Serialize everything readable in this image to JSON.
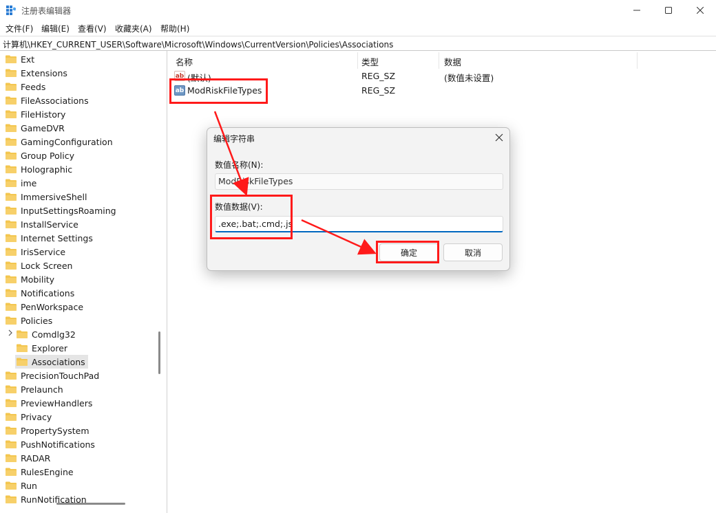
{
  "window": {
    "title": "注册表编辑器",
    "minimize_icon": "minimize-icon",
    "maximize_icon": "maximize-icon",
    "close_icon": "close-icon"
  },
  "menu": [
    "文件(F)",
    "编辑(E)",
    "查看(V)",
    "收藏夹(A)",
    "帮助(H)"
  ],
  "address": "计算机\\HKEY_CURRENT_USER\\Software\\Microsoft\\Windows\\CurrentVersion\\Policies\\Associations",
  "tree": {
    "items": [
      {
        "label": "Ext",
        "indent": 0
      },
      {
        "label": "Extensions",
        "indent": 0
      },
      {
        "label": "Feeds",
        "indent": 0
      },
      {
        "label": "FileAssociations",
        "indent": 0
      },
      {
        "label": "FileHistory",
        "indent": 0
      },
      {
        "label": "GameDVR",
        "indent": 0
      },
      {
        "label": "GamingConfiguration",
        "indent": 0
      },
      {
        "label": "Group Policy",
        "indent": 0
      },
      {
        "label": "Holographic",
        "indent": 0
      },
      {
        "label": "ime",
        "indent": 0
      },
      {
        "label": "ImmersiveShell",
        "indent": 0
      },
      {
        "label": "InputSettingsRoaming",
        "indent": 0
      },
      {
        "label": "InstallService",
        "indent": 0
      },
      {
        "label": "Internet Settings",
        "indent": 0
      },
      {
        "label": "IrisService",
        "indent": 0
      },
      {
        "label": "Lock Screen",
        "indent": 0
      },
      {
        "label": "Mobility",
        "indent": 0
      },
      {
        "label": "Notifications",
        "indent": 0
      },
      {
        "label": "PenWorkspace",
        "indent": 0
      },
      {
        "label": "Policies",
        "indent": 0
      },
      {
        "label": "Comdlg32",
        "indent": 1
      },
      {
        "label": "Explorer",
        "indent": 1
      },
      {
        "label": "Associations",
        "indent": 1,
        "selected": true
      },
      {
        "label": "PrecisionTouchPad",
        "indent": 0
      },
      {
        "label": "Prelaunch",
        "indent": 0
      },
      {
        "label": "PreviewHandlers",
        "indent": 0
      },
      {
        "label": "Privacy",
        "indent": 0
      },
      {
        "label": "PropertySystem",
        "indent": 0
      },
      {
        "label": "PushNotifications",
        "indent": 0
      },
      {
        "label": "RADAR",
        "indent": 0
      },
      {
        "label": "RulesEngine",
        "indent": 0
      },
      {
        "label": "Run",
        "indent": 0
      },
      {
        "label": "RunNotification",
        "indent": 0
      }
    ]
  },
  "list": {
    "headers": {
      "name": "名称",
      "type": "类型",
      "data": "数据"
    },
    "rows": [
      {
        "name": "(默认)",
        "type": "REG_SZ",
        "data": "(数值未设置)",
        "icon": "string-value-icon"
      },
      {
        "name": "ModRiskFileTypes",
        "type": "REG_SZ",
        "data": "",
        "icon": "string-value-icon"
      }
    ]
  },
  "dialog": {
    "title": "编辑字符串",
    "name_label": "数值名称(N):",
    "name_value": "ModRiskFileTypes",
    "data_label": "数值数据(V):",
    "data_value": ".exe;.bat;.cmd;.js",
    "ok_label": "确定",
    "cancel_label": "取消"
  },
  "colors": {
    "annotation": "#ff1a1a",
    "folder": "#f3c64f",
    "accent": "#0067c0"
  }
}
